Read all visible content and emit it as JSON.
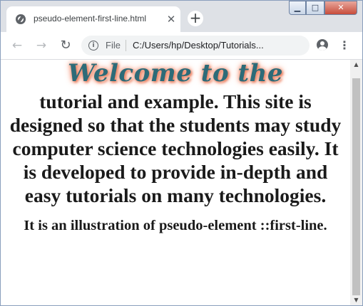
{
  "browser": {
    "tab": {
      "title": "pseudo-element-first-line.html",
      "close_glyph": "✕"
    },
    "new_tab_glyph": "+",
    "window_controls": {
      "minimize": "▁",
      "maximize": "□",
      "close": "✕"
    },
    "toolbar": {
      "back_glyph": "←",
      "forward_glyph": "→",
      "reload_glyph": "↻",
      "info_glyph": "i",
      "scheme_label": "File",
      "url": "C:/Users/hp/Desktop/Tutorials...",
      "star_glyph": "☆",
      "menu_glyph": "⋮"
    }
  },
  "content": {
    "paragraph1_first_line": "Welcome to the",
    "paragraph1_rest": "tutorial and example. This site is designed so that the students may study computer science technologies easily. It is developed to provide in-depth and easy tutorials on many technologies.",
    "paragraph2": "It is an illustration of pseudo-element ::first-line."
  },
  "scrollbar": {
    "up_glyph": "▲",
    "down_glyph": "▼"
  },
  "colors": {
    "first_line_text": "#2d6b78",
    "first_line_glow": "#f08a6a",
    "body_text": "#1a1a1a"
  }
}
